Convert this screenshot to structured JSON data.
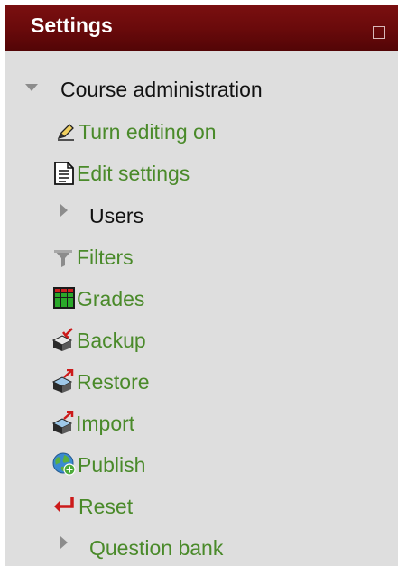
{
  "block": {
    "title": "Settings",
    "colors": {
      "header_bg": "#6a0a0b",
      "panel_bg": "#dedede",
      "link": "#4a8a2a",
      "text": "#111111"
    }
  },
  "tree": {
    "course_admin": "Course administration",
    "items": [
      {
        "label": "Turn editing on",
        "icon": "pencil-icon"
      },
      {
        "label": "Edit settings",
        "icon": "document-icon"
      },
      {
        "label": "Users",
        "icon": "expand-arrow-icon"
      },
      {
        "label": "Filters",
        "icon": "funnel-icon"
      },
      {
        "label": "Grades",
        "icon": "spreadsheet-icon"
      },
      {
        "label": "Backup",
        "icon": "backup-icon"
      },
      {
        "label": "Restore",
        "icon": "restore-icon"
      },
      {
        "label": "Import",
        "icon": "import-icon"
      },
      {
        "label": "Publish",
        "icon": "globe-icon"
      },
      {
        "label": "Reset",
        "icon": "reset-arrow-icon"
      },
      {
        "label": "Question bank",
        "icon": "expand-arrow-icon"
      }
    ]
  }
}
